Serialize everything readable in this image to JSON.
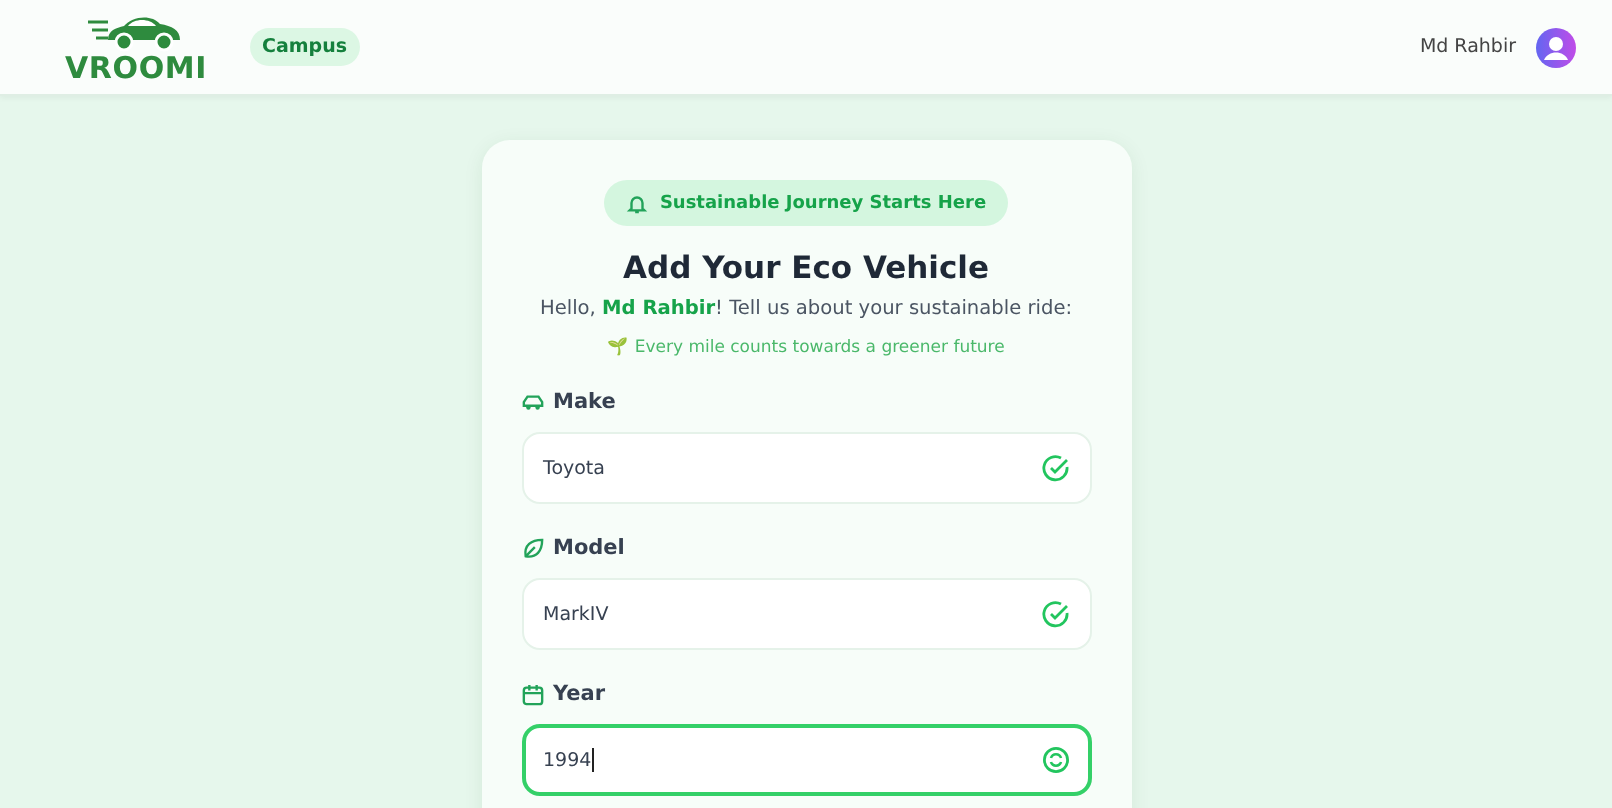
{
  "header": {
    "logo": "VROOMI",
    "tag": "Campus",
    "user": "Md Rahbir"
  },
  "card": {
    "badge": "Sustainable Journey Starts Here",
    "title": "Add Your Eco Vehicle",
    "greeting": "Hello, **Md Rahbir**! Tell us about your sustainable ride:",
    "tagline": "🌱 Every mile counts towards a greener future"
  },
  "fields": [
    {
      "kind": "car",
      "label": "Make",
      "value": "Toyota",
      "focused": false,
      "valid": true
    },
    {
      "kind": "leaf",
      "label": "Model",
      "value": "MarkIV",
      "focused": false,
      "valid": true
    },
    {
      "kind": "calendar",
      "label": "Year",
      "value": "1994",
      "focused": true,
      "valid": false
    }
  ]
}
